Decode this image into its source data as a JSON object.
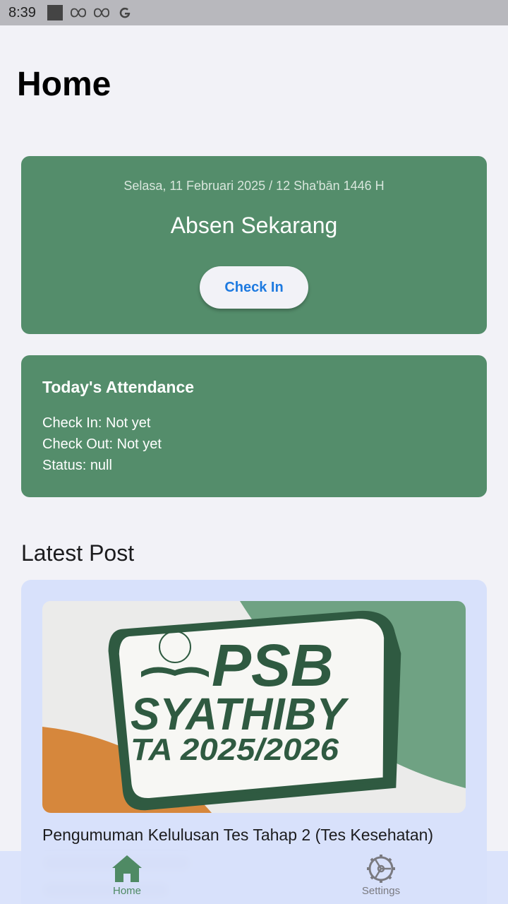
{
  "status_bar": {
    "time": "8:39",
    "icons": [
      "square-icon",
      "infinity-icon",
      "infinity-icon",
      "google-icon"
    ]
  },
  "header": {
    "title": "Home"
  },
  "checkin_card": {
    "date": "Selasa, 11 Februari 2025 / 12 Sha'bān 1446 H",
    "title": "Absen Sekarang",
    "button_label": "Check In"
  },
  "attendance": {
    "title": "Today's Attendance",
    "check_in": "Check In: Not yet",
    "check_out": "Check Out: Not yet",
    "status": "Status: null"
  },
  "latest_post": {
    "section_title": "Latest Post",
    "image": {
      "line1": "PSB",
      "line2": "SYATHIBY",
      "line3": "TA 2025/2026"
    },
    "post_title": "Pengumuman Kelulusan Tes Tahap 2 (Tes Kesehatan)"
  },
  "bottom_nav": {
    "items": [
      {
        "label": "Home",
        "icon": "home-icon"
      },
      {
        "label": "Settings",
        "icon": "settings-icon"
      }
    ]
  },
  "colors": {
    "primary_green": "#548d6b",
    "accent_blue": "#1e7ae0",
    "post_bg": "#d8e1fb"
  }
}
